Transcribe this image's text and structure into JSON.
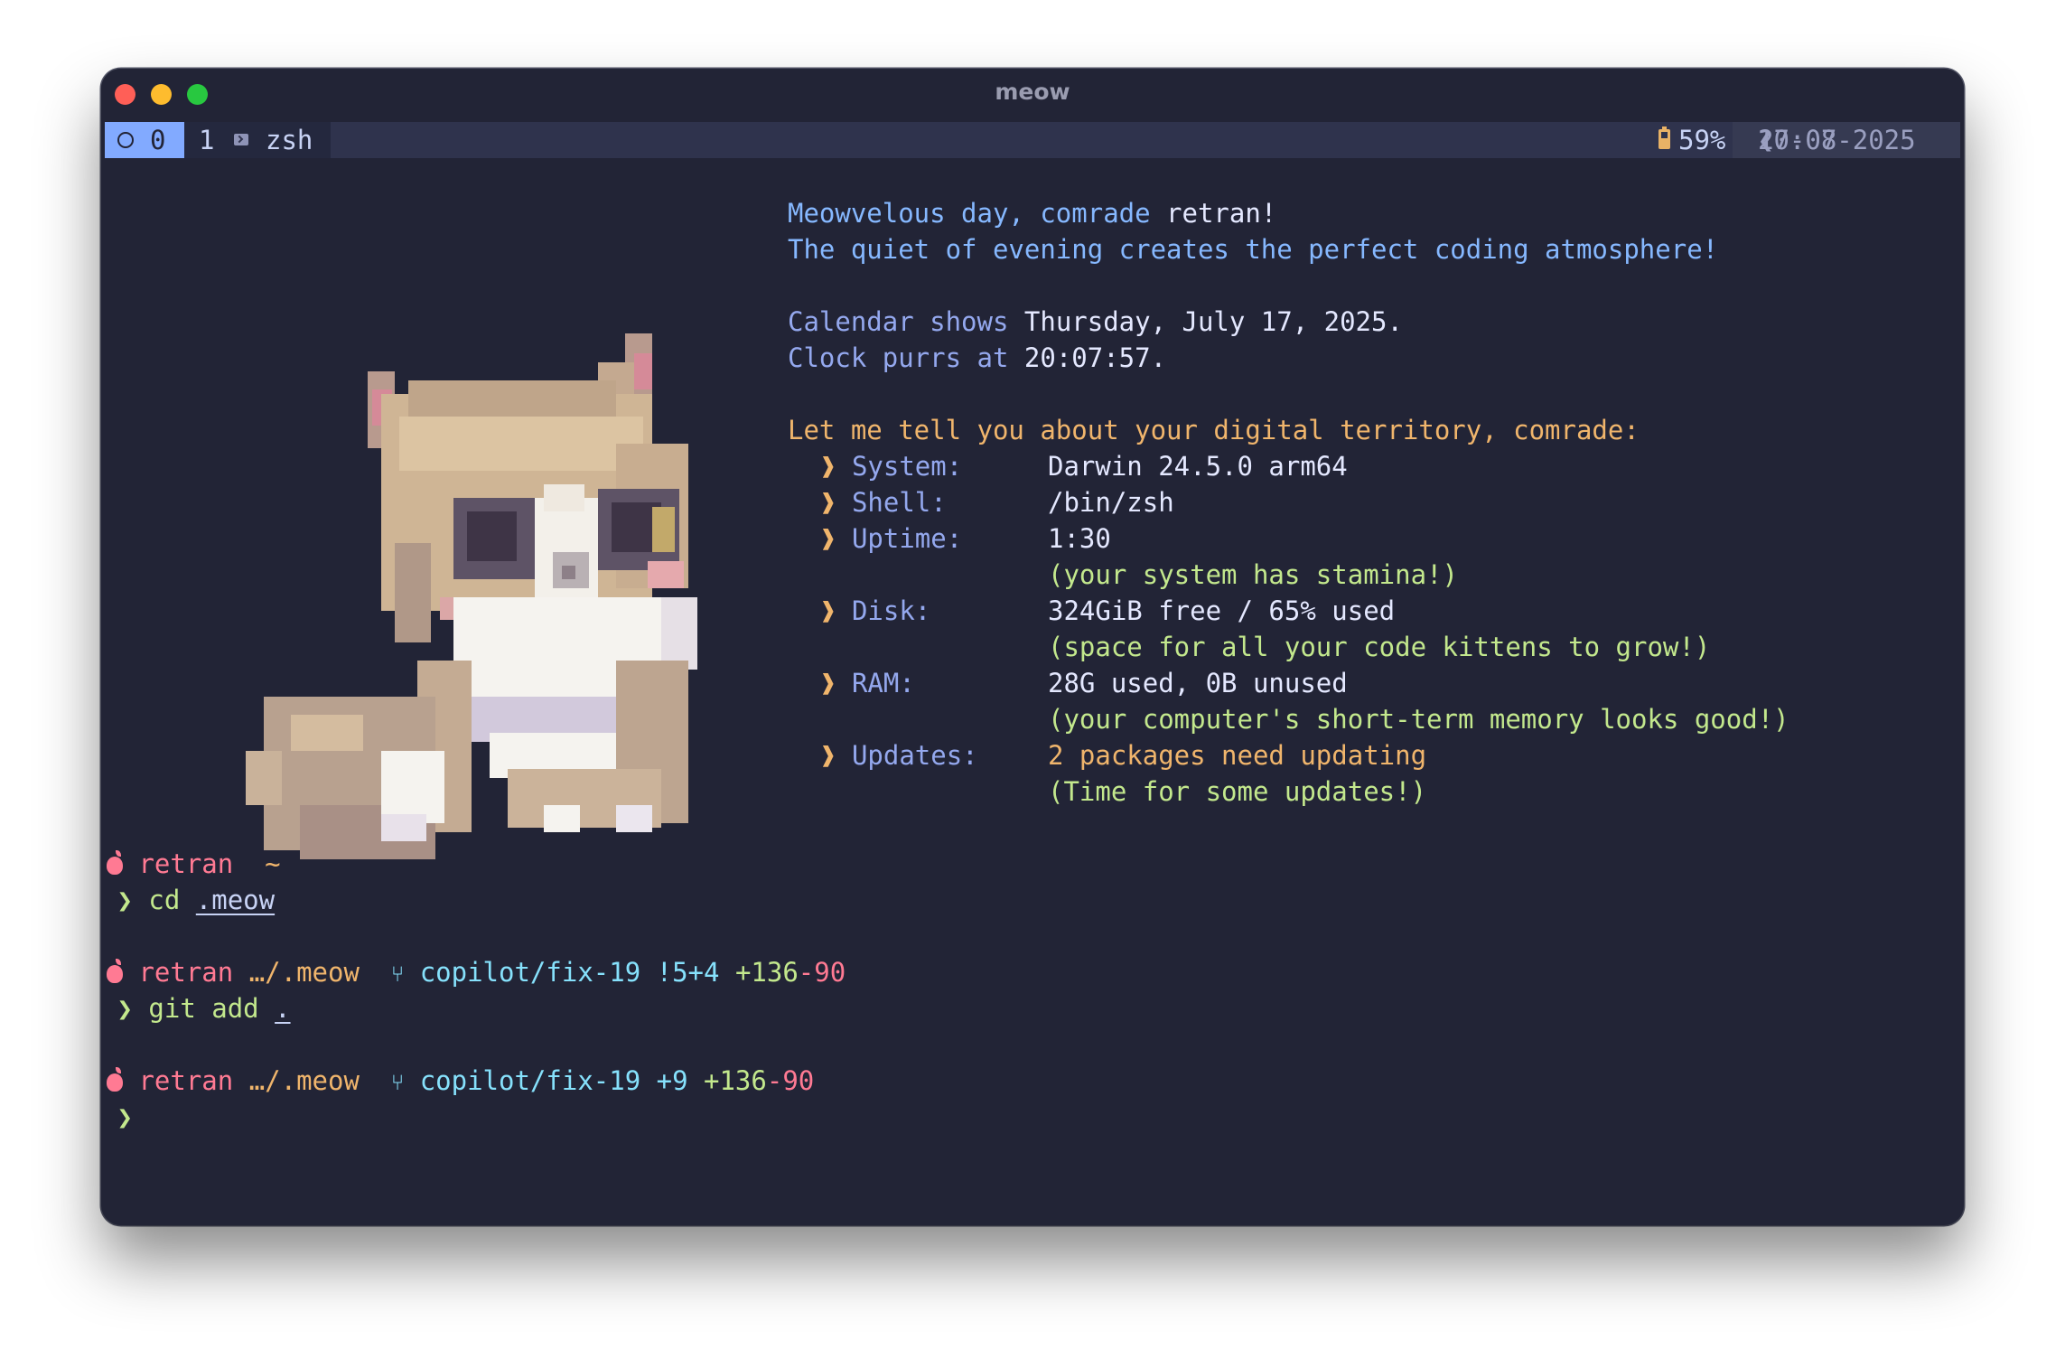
{
  "window": {
    "title": "meow"
  },
  "tmux": {
    "windows": [
      {
        "index": "0",
        "active": true
      },
      {
        "index": "1",
        "name": "zsh",
        "icon": "terminal-icon"
      }
    ],
    "battery": "59%",
    "date": "17-07-2025",
    "time": "20:08",
    "separator": "❮"
  },
  "greeting": {
    "line1_a": "Meowvelous day, comrade ",
    "user": "retran!",
    "line2": "The quiet of evening creates the perfect coding atmosphere!",
    "cal_label": "Calendar shows ",
    "cal_value": "Thursday, July 17, 2025.",
    "clock_label": "Clock purrs at ",
    "clock_value": "20:07:57."
  },
  "sysinfo": {
    "heading": "Let me tell you about your digital territory, comrade:",
    "bullet": "❱",
    "items": [
      {
        "label": "System:",
        "value": "Darwin 24.5.0 arm64",
        "note": ""
      },
      {
        "label": "Shell:",
        "value": "/bin/zsh",
        "note": ""
      },
      {
        "label": "Uptime:",
        "value": "1:30",
        "note": "(your system has stamina!)"
      },
      {
        "label": "Disk:",
        "value": "324GiB free / 65% used",
        "note": "(space for all your code kittens to grow!)"
      },
      {
        "label": "RAM:",
        "value": "28G used, 0B unused",
        "note": "(your computer's short-term memory looks good!)"
      },
      {
        "label": "Updates:",
        "value": "2 packages need updating",
        "note": "(Time for some updates!)"
      }
    ]
  },
  "prompts": [
    {
      "user": "retran",
      "dir": "~",
      "branch": "",
      "status": "",
      "diff_add": "",
      "diff_del": "",
      "cmd": "cd",
      "arg": ".meow"
    },
    {
      "user": "retran",
      "dir": "…/.meow",
      "branch": "copilot/fix-19",
      "status": "!5+4",
      "diff_add": "+136",
      "diff_del": "-90",
      "cmd": "git add",
      "arg": "."
    },
    {
      "user": "retran",
      "dir": "…/.meow",
      "branch": "copilot/fix-19",
      "status": "+9",
      "diff_add": "+136",
      "diff_del": "-90",
      "cmd": "",
      "arg": ""
    }
  ],
  "prompt_char": "❯",
  "colors": {
    "background": "#222436",
    "accent_blue": "#82aaff",
    "orange": "#f0b56c",
    "green": "#c3e88d",
    "pink": "#ff7a93",
    "cyan": "#86e1fc"
  }
}
